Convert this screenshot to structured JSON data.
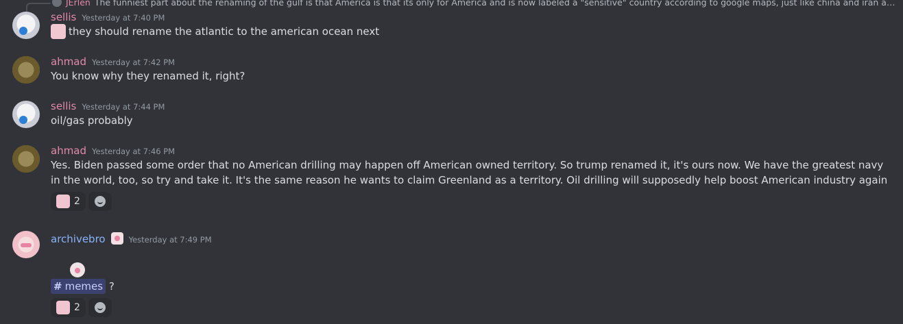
{
  "reply_preview": {
    "author": "JErlen",
    "text": "The funniest part about the renaming of the gulf is that America is that its only for America and is now labeled a \"sensitive\" country according to google maps, just like china and iran and other co..."
  },
  "messages": [
    {
      "author": "sellis",
      "timestamp": "Yesterday at 7:40 PM",
      "text": "they should rename the atlantic to the american ocean next"
    },
    {
      "author": "ahmad",
      "timestamp": "Yesterday at 7:42 PM",
      "text": "You know why they renamed it, right?"
    },
    {
      "author": "sellis",
      "timestamp": "Yesterday at 7:44 PM",
      "text": "oil/gas probably"
    },
    {
      "author": "ahmad",
      "timestamp": "Yesterday at 7:46 PM",
      "text": "Yes. Biden passed some order that no American drilling may happen off American owned territory. So trump renamed it, it's ours now. We have the greatest navy in the world, too, so try and take it. It's the same reason he wants to claim Greenland as a territory. Oil drilling will supposedly help boost American industry again",
      "reaction_count": "2"
    },
    {
      "author": "archivebro",
      "timestamp": "Yesterday at 7:49 PM",
      "channel_mention": "memes",
      "trailing_text": "?",
      "reaction_count": "2"
    }
  ],
  "colors": {
    "background": "#313338",
    "author_pink": "#e38aa8",
    "author_blue": "#8ab4f8",
    "mention_bg": "#3c4270"
  },
  "icons": {
    "add_reaction": "smile-icon",
    "channel": "hash-icon"
  }
}
